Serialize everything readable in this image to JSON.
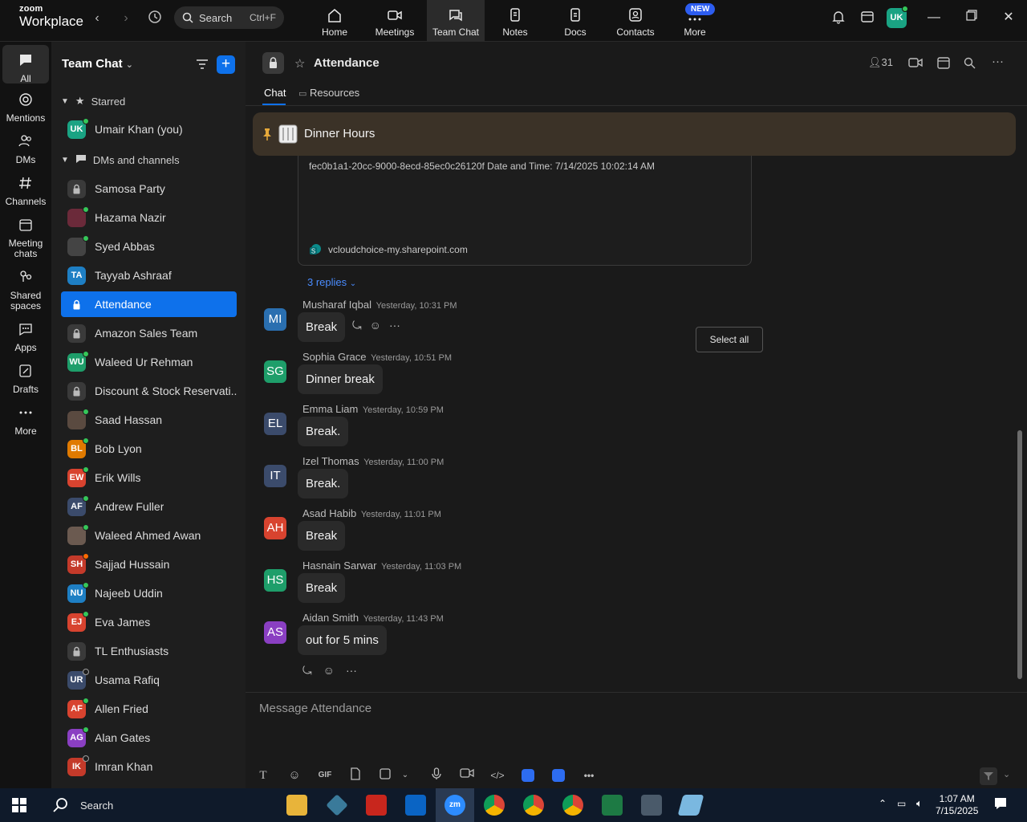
{
  "app": {
    "brand_small": "zoom",
    "brand_large": "Workplace",
    "search_label": "Search",
    "search_shortcut": "Ctrl+F",
    "new_badge": "NEW",
    "user_initials": "UK"
  },
  "top_tabs": [
    {
      "label": "Home"
    },
    {
      "label": "Meetings"
    },
    {
      "label": "Team Chat"
    },
    {
      "label": "Notes"
    },
    {
      "label": "Docs"
    },
    {
      "label": "Contacts"
    },
    {
      "label": "More"
    }
  ],
  "rail": [
    {
      "label": "All"
    },
    {
      "label": "Mentions"
    },
    {
      "label": "DMs"
    },
    {
      "label": "Channels"
    },
    {
      "label": "Meeting chats"
    },
    {
      "label": "Shared spaces"
    },
    {
      "label": "Apps"
    },
    {
      "label": "Drafts"
    },
    {
      "label": "More"
    }
  ],
  "sidebar": {
    "title": "Team Chat",
    "starred_label": "Starred",
    "starred_items": [
      {
        "name": "Umair Khan (you)",
        "initials": "UK",
        "color": "#1aa383",
        "status": "online"
      }
    ],
    "dms_label": "DMs and channels",
    "items": [
      {
        "name": "Samosa Party",
        "initials": "",
        "color": "#3a3a3a",
        "type": "lock"
      },
      {
        "name": "Hazama Nazir",
        "initials": "",
        "color": "#6b2a3a",
        "status": "online"
      },
      {
        "name": "Syed Abbas",
        "initials": "",
        "color": "#444",
        "status": "online"
      },
      {
        "name": "Tayyab Ashraaf",
        "initials": "TA",
        "color": "#1e7fc4"
      },
      {
        "name": "Attendance",
        "initials": "",
        "color": "#0e71eb",
        "type": "lock-active"
      },
      {
        "name": "Amazon Sales Team",
        "initials": "",
        "color": "#3a3a3a",
        "type": "lock"
      },
      {
        "name": "Waleed Ur Rehman",
        "initials": "WU",
        "color": "#1e9e6a",
        "status": "online"
      },
      {
        "name": "Discount & Stock Reservati...",
        "initials": "",
        "color": "#3a3a3a",
        "type": "lock"
      },
      {
        "name": "Saad Hassan",
        "initials": "",
        "color": "#5a4a40",
        "status": "online"
      },
      {
        "name": "Bob Lyon",
        "initials": "BL",
        "color": "#e07a00",
        "status": "online"
      },
      {
        "name": "Erik Wills",
        "initials": "EW",
        "color": "#d8432f",
        "status": "online"
      },
      {
        "name": "Andrew Fuller",
        "initials": "AF",
        "color": "#3b4b6b",
        "status": "online"
      },
      {
        "name": "Waleed Ahmed Awan",
        "initials": "",
        "color": "#6b5a50",
        "status": "online"
      },
      {
        "name": "Sajjad Hussain",
        "initials": "SH",
        "color": "#c43a2a",
        "status": "busy"
      },
      {
        "name": "Najeeb Uddin",
        "initials": "NU",
        "color": "#1e7fc4",
        "status": "online"
      },
      {
        "name": "Eva James",
        "initials": "EJ",
        "color": "#d8432f",
        "status": "online"
      },
      {
        "name": "TL Enthusiasts",
        "initials": "",
        "color": "#3a3a3a",
        "type": "lock"
      },
      {
        "name": "Usama Rafiq",
        "initials": "UR",
        "color": "#3b4b6b",
        "status": "offline"
      },
      {
        "name": "Allen Fried",
        "initials": "AF",
        "color": "#d8432f",
        "status": "online"
      },
      {
        "name": "Alan Gates",
        "initials": "AG",
        "color": "#8a3fc2",
        "status": "online"
      },
      {
        "name": "Imran Khan",
        "initials": "IK",
        "color": "#c43a2a",
        "status": "offline"
      }
    ]
  },
  "channel": {
    "title": "Attendance",
    "member_count": "31",
    "tabs": [
      {
        "label": "Chat"
      },
      {
        "label": "Resources"
      }
    ],
    "pinned_title": "Dinner Hours",
    "attachment_text": "fec0b1a1-20cc-9000-8ecd-85ec0c26120f Date and Time: 7/14/2025 10:02:14 AM",
    "attachment_source": "vcloudchoice-my.sharepoint.com",
    "replies": "3 replies",
    "select_all": "Select all",
    "composer_placeholder": "Message Attendance"
  },
  "messages": [
    {
      "author": "Musharaf Iqbal",
      "time": "Yesterday, 10:31 PM",
      "text": "Break",
      "initials": "MI",
      "color": "#2a6fb0"
    },
    {
      "author": "Sophia Grace",
      "time": "Yesterday, 10:51 PM",
      "text": "Dinner break",
      "initials": "SG",
      "color": "#1e9e6a"
    },
    {
      "author": "Emma Liam",
      "time": "Yesterday, 10:59 PM",
      "text": "Break.",
      "initials": "EL",
      "color": "#3b4b6b"
    },
    {
      "author": "Izel Thomas",
      "time": "Yesterday, 11:00 PM",
      "text": "Break.",
      "initials": "IT",
      "color": "#3b4b6b"
    },
    {
      "author": "Asad Habib",
      "time": "Yesterday, 11:01 PM",
      "text": "Break",
      "initials": "AH",
      "color": "#d8432f"
    },
    {
      "author": "Hasnain Sarwar",
      "time": "Yesterday, 11:03 PM",
      "text": "Break",
      "initials": "HS",
      "color": "#1e9e6a"
    },
    {
      "author": "Aidan Smith",
      "time": "Yesterday, 11:43 PM",
      "text": "out for 5 mins",
      "initials": "AS",
      "color": "#8a3fc2"
    }
  ],
  "composer_tools": [
    "format-icon",
    "emoji-icon",
    "gif-icon",
    "file-icon",
    "screenshot-icon",
    "dropdown-icon",
    "mic-icon",
    "video-icon",
    "code-icon",
    "app-icon",
    "app2-icon",
    "more-icon"
  ],
  "taskbar": {
    "search_label": "Search",
    "time": "1:07 AM",
    "date": "7/15/2025"
  }
}
